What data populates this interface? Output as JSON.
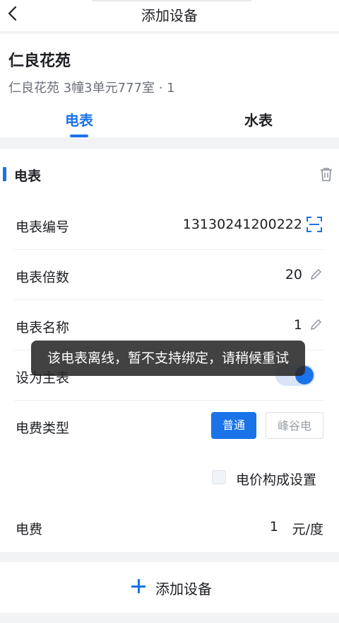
{
  "nav": {
    "title": "添加设备"
  },
  "header": {
    "community": "仁良花苑",
    "address": "仁良花苑 3幢3单元777室 · 1",
    "tabs": [
      {
        "label": "电表",
        "active": true
      },
      {
        "label": "水表",
        "active": false
      }
    ]
  },
  "section": {
    "title": "电表",
    "rows": {
      "meter_number": {
        "label": "电表编号",
        "value": "13130241200222"
      },
      "multiplier": {
        "label": "电表倍数",
        "value": "20"
      },
      "name": {
        "label": "电表名称",
        "value": "1"
      },
      "main_meter": {
        "label": "设为主表",
        "enabled": true
      },
      "fee_type": {
        "label": "电费类型",
        "options": [
          "普通",
          "峰谷电"
        ],
        "selected": "普通"
      },
      "price_setting": {
        "label": "电价构成设置",
        "checked": false
      },
      "fee": {
        "label": "电费",
        "value": "1",
        "unit": "元/度"
      }
    }
  },
  "footer": {
    "add_label": "添加设备"
  },
  "toast": {
    "message": "该电表离线，暂不支持绑定，请稍候重试"
  },
  "colors": {
    "accent": "#1a73e8",
    "toast_bg": "#282828"
  }
}
